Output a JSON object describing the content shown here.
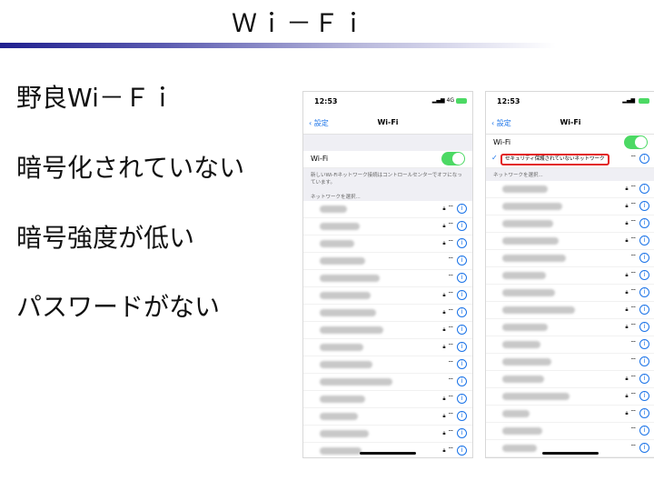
{
  "slide": {
    "title": "Ｗｉ－Ｆｉ",
    "bullets": [
      "野良Wi－Ｆｉ",
      "暗号化されていない",
      "暗号強度が低い",
      "パスワードがない"
    ]
  },
  "phones": [
    {
      "status_time": "12:53",
      "status_network": "4G",
      "back_label": "設定",
      "nav_title": "Wi-Fi",
      "wifi_label": "Wi-Fi",
      "wifi_toggle_on": true,
      "note": "新しいWi-Fiネットワーク接続はコントロールセンターでオフになっています。",
      "section_label": "ネットワークを選択...",
      "networks_locked": [
        true,
        true,
        true,
        false,
        false,
        true,
        true,
        true,
        true,
        false,
        false,
        true,
        true,
        true,
        true,
        true
      ]
    },
    {
      "status_time": "12:53",
      "back_label": "設定",
      "nav_title": "Wi-Fi",
      "wifi_label": "Wi-Fi",
      "wifi_toggle_on": true,
      "connected_network": "セキュリティ保護されていないネットワーク",
      "section_label": "ネットワークを選択...",
      "networks_locked": [
        true,
        true,
        true,
        true,
        false,
        true,
        true,
        true,
        true,
        false,
        false,
        true,
        true,
        true,
        false,
        false
      ]
    }
  ],
  "icons": {
    "lock": "lock-icon",
    "wifi": "wifi-signal-icon",
    "info": "info-icon",
    "check": "checkmark-icon"
  },
  "colors": {
    "toggle_on": "#4cd964",
    "ios_blue": "#1a73e8",
    "highlight_red": "#e21f1f"
  }
}
